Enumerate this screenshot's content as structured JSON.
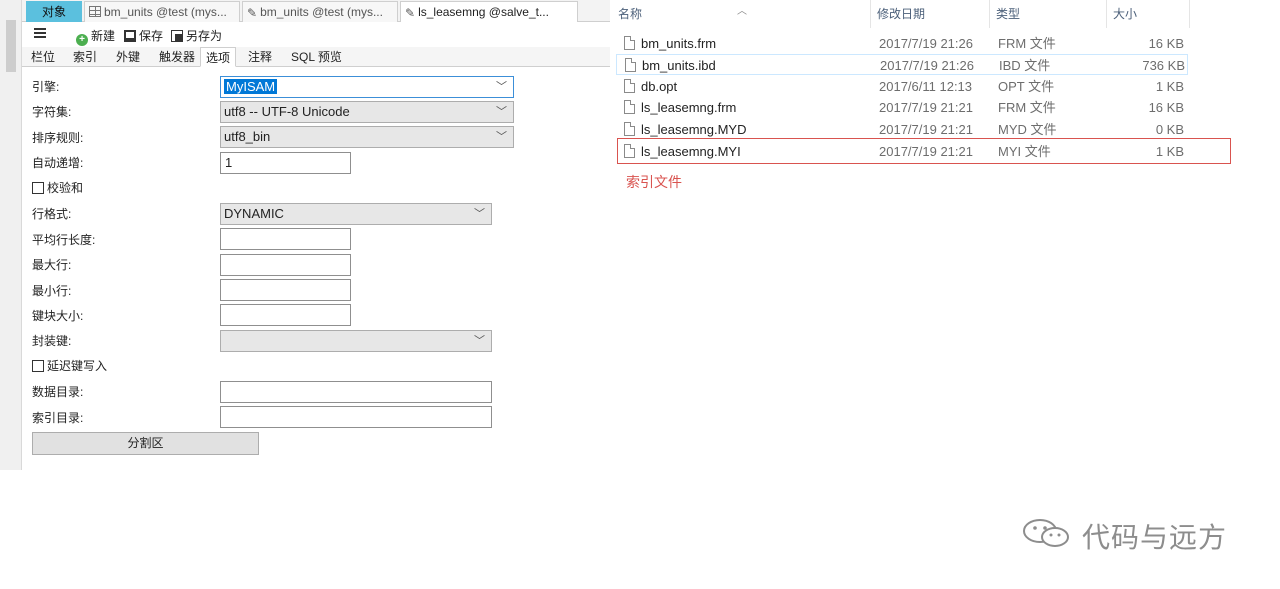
{
  "left": {
    "doc_tabs": [
      {
        "label": "对象"
      },
      {
        "label": "bm_units @test (mys..."
      },
      {
        "label": "bm_units @test (mys..."
      },
      {
        "label": "ls_leasemng @salve_t..."
      }
    ],
    "toolbar": {
      "new_label": "新建",
      "save_label": "保存",
      "saveas_label": "另存为"
    },
    "sub_tabs": [
      "栏位",
      "索引",
      "外键",
      "触发器",
      "选项",
      "注释",
      "SQL 预览"
    ],
    "active_sub_tab": "选项",
    "options": {
      "engine_label": "引擎:",
      "engine_value": "MyISAM",
      "charset_label": "字符集:",
      "charset_value": "utf8 -- UTF-8 Unicode",
      "collation_label": "排序规则:",
      "collation_value": "utf8_bin",
      "auto_inc_label": "自动递增:",
      "auto_inc_value": "1",
      "checksum_label": "校验和",
      "row_format_label": "行格式:",
      "row_format_value": "DYNAMIC",
      "avg_row_len_label": "平均行长度:",
      "max_rows_label": "最大行:",
      "min_rows_label": "最小行:",
      "key_block_label": "键块大小:",
      "pack_keys_label": "封装键:",
      "delay_key_label": "延迟键写入",
      "data_dir_label": "数据目录:",
      "index_dir_label": "索引目录:",
      "partition_label": "分割区"
    }
  },
  "explorer": {
    "columns": {
      "name": "名称",
      "date": "修改日期",
      "type": "类型",
      "size": "大小"
    },
    "files": [
      {
        "name": "bm_units.frm",
        "date": "2017/7/19 21:26",
        "type": "FRM 文件",
        "size": "16 KB"
      },
      {
        "name": "bm_units.ibd",
        "date": "2017/7/19 21:26",
        "type": "IBD 文件",
        "size": "736 KB"
      },
      {
        "name": "db.opt",
        "date": "2017/6/11 12:13",
        "type": "OPT 文件",
        "size": "1 KB"
      },
      {
        "name": "ls_leasemng.frm",
        "date": "2017/7/19 21:21",
        "type": "FRM 文件",
        "size": "16 KB"
      },
      {
        "name": "ls_leasemng.MYD",
        "date": "2017/7/19 21:21",
        "type": "MYD 文件",
        "size": "0 KB"
      },
      {
        "name": "ls_leasemng.MYI",
        "date": "2017/7/19 21:21",
        "type": "MYI 文件",
        "size": "1 KB"
      }
    ],
    "annotation": "索引文件"
  },
  "watermark": {
    "text": "代码与远方"
  },
  "colors": {
    "accent_tab": "#5bc0de",
    "annotation": "#d9534f",
    "selection": "#0078d7"
  }
}
